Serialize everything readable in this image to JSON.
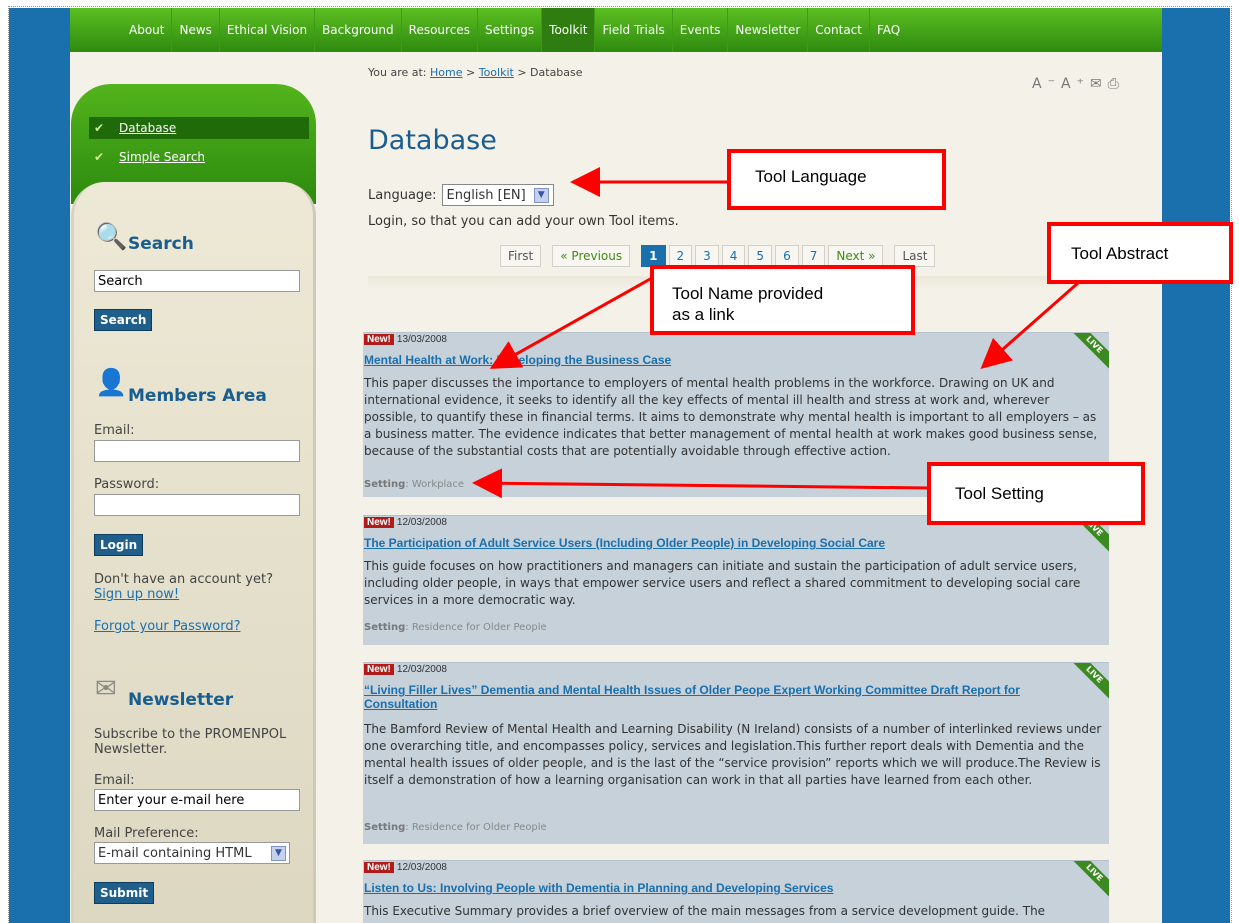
{
  "nav": {
    "items": [
      "About",
      "News",
      "Ethical Vision",
      "Background",
      "Resources",
      "Settings",
      "Toolkit",
      "Field Trials",
      "Events",
      "Newsletter",
      "Contact",
      "FAQ"
    ],
    "active": "Toolkit"
  },
  "sidebar": {
    "links": [
      "Database",
      "Simple Search"
    ],
    "search": {
      "title": "Search",
      "placeholder": "Search",
      "button": "Search"
    },
    "members": {
      "title": "Members Area",
      "email_label": "Email:",
      "password_label": "Password:",
      "login_button": "Login",
      "no_account": "Don't have an account yet?",
      "signup": "Sign up now!",
      "forgot": "Forgot your Password?"
    },
    "newsletter": {
      "title": "Newsletter",
      "desc_line1": "Subscribe to the PROMENPOL",
      "desc_line2": "Newsletter.",
      "email_label": "Email:",
      "email_value": "Enter your e-mail here",
      "pref_label": "Mail Preference:",
      "pref_value": "E-mail containing HTML",
      "submit_button": "Submit"
    }
  },
  "breadcrumb": {
    "prefix": "You are at:",
    "home": "Home",
    "sep1": ">",
    "toolkit": "Toolkit",
    "sep2": ">",
    "current": "Database"
  },
  "page_title": "Database",
  "language": {
    "label": "Language:",
    "value": "English [EN]"
  },
  "login_note": "Login, so that you can add your own Tool items.",
  "pager": {
    "first": "First",
    "previous": "Previous",
    "pages": [
      "1",
      "2",
      "3",
      "4",
      "5",
      "6",
      "7"
    ],
    "current": "1",
    "next": "Next",
    "last": "Last"
  },
  "items": [
    {
      "badge": "New!",
      "date": "13/03/2008",
      "title": "Mental Health at Work: Developing the Business Case",
      "abstract": "This paper discusses the importance to employers of mental health problems in the workforce. Drawing on UK and international evidence, it seeks to identify all the key effects of mental ill health and stress at work and, wherever possible, to quantify these in financial terms. It aims to demonstrate why mental health is important to all employers – as a business matter. The evidence indicates that better management of mental health at work makes good business sense, because of the substantial costs that are potentially avoidable through effective action.",
      "setting_label": "Setting",
      "setting": "Workplace",
      "live": "LIVE"
    },
    {
      "badge": "New!",
      "date": "12/03/2008",
      "title": "The Participation of Adult Service Users (Including Older People) in Developing Social Care",
      "abstract": "This guide focuses on how practitioners and managers can initiate and sustain the participation of adult service users, including older people, in ways that empower service users and reflect a shared commitment to developing social care services in a more democratic way.",
      "setting_label": "Setting",
      "setting": "Residence for Older People",
      "live": "LIVE"
    },
    {
      "badge": "New!",
      "date": "12/03/2008",
      "title": "“Living Filler Lives” Dementia and Mental Health Issues of Older Peope Expert Working Committee Draft Report for Consultation",
      "abstract": "The Bamford Review of Mental Health and Learning Disability (N Ireland) consists of a number of interlinked reviews under one overarching title, and encompasses policy, services and legislation.This further report deals with Dementia and the mental health issues of older people, and is the last of the “service provision” reports which we will produce.The Review is itself a demonstration of how a learning organisation can work in that all parties have learned from each other.",
      "setting_label": "Setting",
      "setting": "Residence for Older People",
      "live": "LIVE"
    },
    {
      "badge": "New!",
      "date": "12/03/2008",
      "title": "Listen to Us: Involving People with Dementia in Planning and Developing Services",
      "abstract": "This Executive Summary provides a brief overview of the main messages from a service development guide. The",
      "setting_label": "",
      "setting": "",
      "live": "LIVE"
    }
  ],
  "callouts": {
    "language": "Tool Language",
    "abstract": "Tool Abstract",
    "name_line1": "Tool Name provided",
    "name_line2": "as a link",
    "setting": "Tool Setting"
  },
  "colors": {
    "nav_green": "#3a9a15",
    "side_blue": "#1a6fad",
    "callout_red": "#ff0000",
    "item_bg": "#c6d1da"
  }
}
